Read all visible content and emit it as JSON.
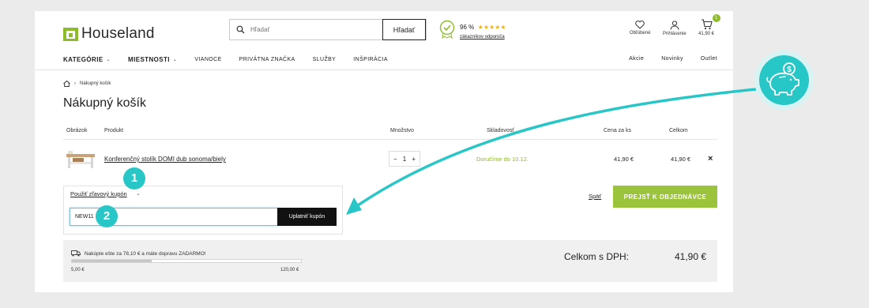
{
  "header": {
    "brand": "Houseland",
    "search": {
      "placeholder": "Hľadať",
      "button": "Hľadať"
    },
    "rating": {
      "percent": "96 %",
      "stars": "★★★★★",
      "link": "zákazníkov odporúča"
    },
    "icons": {
      "favorites": "Obľúbené",
      "account": "Prihlásenie",
      "cart_total": "41,90 €",
      "cart_count": "1"
    }
  },
  "nav": {
    "items": [
      {
        "label": "KATEGÓRIE",
        "chevron": true
      },
      {
        "label": "MIESTNOSTI",
        "chevron": true
      },
      {
        "label": "VIANOCE"
      },
      {
        "label": "PRIVÁTNA ZNAČKA"
      },
      {
        "label": "SLUŽBY"
      },
      {
        "label": "INŠPIRÁCIA"
      }
    ],
    "right": [
      "Akcie",
      "Novinky",
      "Outlet"
    ]
  },
  "breadcrumb": {
    "current": "Nákupný košík"
  },
  "page_title": "Nákupný košík",
  "table": {
    "headers": {
      "image": "Obrázok",
      "product": "Produkt",
      "quantity": "Množstvo",
      "availability": "Skladovosť",
      "unit_price": "Cena za ks",
      "total": "Celkom"
    },
    "rows": [
      {
        "product": "Konferenčný stolík DOMI dub sonoma/biely",
        "quantity": "1",
        "availability": "Doručíme do 10.12.",
        "unit_price": "41,90 €",
        "total": "41,90 €"
      }
    ]
  },
  "coupon": {
    "toggle_label": "Použiť zľavový kupón",
    "value": "NEW11",
    "apply_button": "Uplatniť kupón"
  },
  "actions": {
    "back": "Späť",
    "checkout": "PREJSŤ K OBJEDNÁVCE"
  },
  "summary": {
    "shipping_message": "Nakúpte ešte za 78,10 € a máte dopravu ZADARMO!",
    "progress_fraction": 0.349,
    "min": "5,00 €",
    "max": "120,00 €",
    "total_label": "Celkom s DPH:",
    "total_value": "41,90 €"
  },
  "annotations": {
    "marker_1": "1",
    "marker_2": "2"
  },
  "colors": {
    "brand_green": "#8dbb2b",
    "checkout_green": "#9cc33c",
    "annotation_teal": "#29c6c8"
  }
}
